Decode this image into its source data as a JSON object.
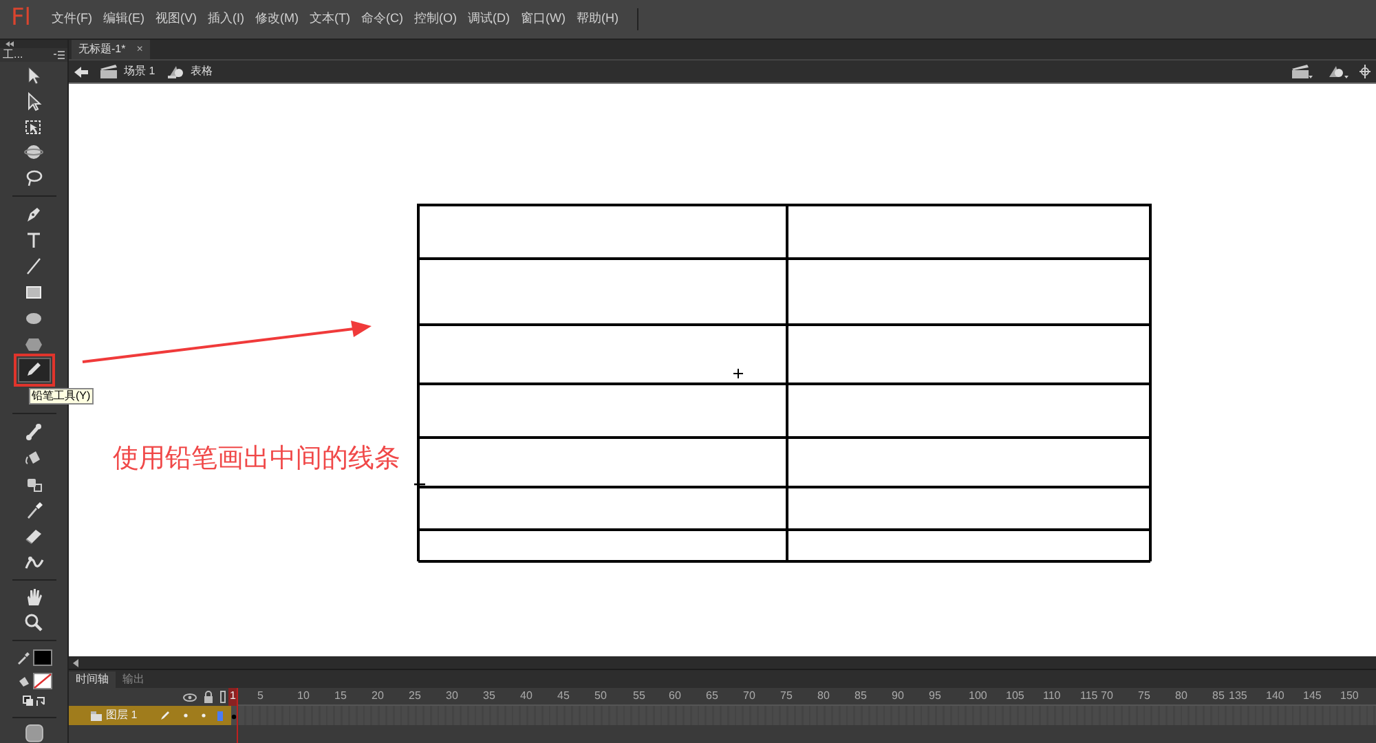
{
  "app": {
    "logo": "Fl"
  },
  "menu": [
    "文件(F)",
    "编辑(E)",
    "视图(V)",
    "插入(I)",
    "修改(M)",
    "文本(T)",
    "命令(C)",
    "控制(O)",
    "调试(D)",
    "窗口(W)",
    "帮助(H)"
  ],
  "tools_panel": {
    "tab": "工..."
  },
  "tools": [
    {
      "kind": "select",
      "selected": false
    },
    {
      "kind": "subselect",
      "selected": false
    },
    {
      "kind": "transform",
      "selected": false
    },
    {
      "kind": "rotate3d",
      "selected": false
    },
    {
      "kind": "lasso",
      "selected": false
    },
    {
      "kind": "divider"
    },
    {
      "kind": "pen",
      "selected": false
    },
    {
      "kind": "text",
      "selected": false
    },
    {
      "kind": "line",
      "selected": false
    },
    {
      "kind": "rect",
      "selected": false
    },
    {
      "kind": "oval",
      "selected": false
    },
    {
      "kind": "polygon",
      "selected": false
    },
    {
      "kind": "pencil",
      "selected": true
    },
    {
      "kind": "divider"
    },
    {
      "kind": "bone",
      "selected": false
    },
    {
      "kind": "bucket",
      "selected": false
    },
    {
      "kind": "inkbottle",
      "selected": false
    },
    {
      "kind": "dropper",
      "selected": false
    },
    {
      "kind": "eraser",
      "selected": false
    },
    {
      "kind": "width",
      "selected": false
    },
    {
      "kind": "divider"
    },
    {
      "kind": "hand",
      "selected": false
    },
    {
      "kind": "zoom",
      "selected": false
    }
  ],
  "tooltip": "铅笔工具(Y)",
  "document_tab": {
    "title": "无标题-1*",
    "close": "×"
  },
  "breadcrumb": {
    "scene": "场景 1",
    "symbol": "表格"
  },
  "annotation": "使用铅笔画出中间的线条",
  "timeline": {
    "tabs": [
      {
        "label": "时间轴",
        "selected": true
      },
      {
        "label": "输出",
        "selected": false
      }
    ],
    "frames": [
      "1",
      "5",
      "10",
      "15",
      "20",
      "25",
      "30",
      "35",
      "40",
      "45",
      "50",
      "55",
      "60",
      "65",
      "70",
      "75",
      "80",
      "85",
      "90",
      "95",
      "100",
      "105",
      "110",
      "115",
      "70",
      "75",
      "80",
      "85",
      "135",
      "140",
      "145",
      "150"
    ],
    "layers": [
      {
        "name": "图层 1",
        "selected": true
      }
    ]
  }
}
